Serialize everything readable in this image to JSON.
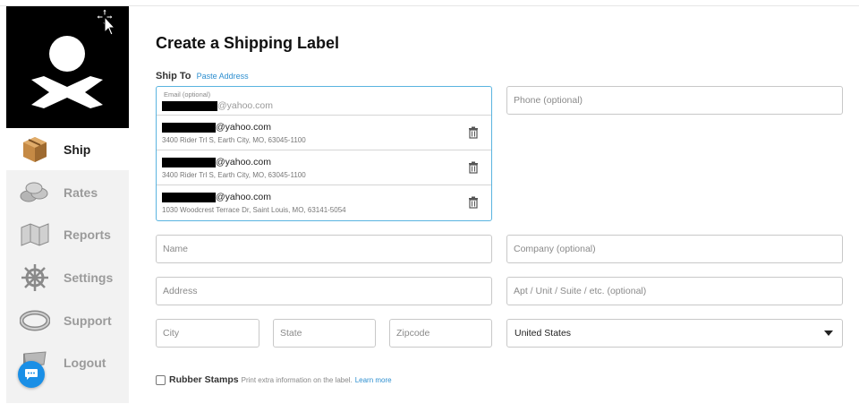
{
  "sidebar": {
    "items": [
      {
        "label": "Ship",
        "active": true
      },
      {
        "label": "Rates"
      },
      {
        "label": "Reports"
      },
      {
        "label": "Settings"
      },
      {
        "label": "Support"
      },
      {
        "label": "Logout"
      }
    ]
  },
  "form": {
    "title": "Create a Shipping Label",
    "ship_to_label": "Ship To",
    "paste_address_link": "Paste Address",
    "email": {
      "label": "Email (optional)",
      "value_suffix": "@yahoo.com"
    },
    "suggestions": [
      {
        "email_suffix": "@yahoo.com",
        "address": "3400 Rider Trl S, Earth City, MO, 63045-1100"
      },
      {
        "email_suffix": "@yahoo.com",
        "address": "3400 Rider Trl S, Earth City, MO, 63045-1100"
      },
      {
        "email_suffix": "@yahoo.com",
        "address": "1030 Woodcrest Terrace Dr, Saint Louis, MO, 63141-5054"
      }
    ],
    "placeholders": {
      "phone": "Phone (optional)",
      "name": "Name",
      "company": "Company (optional)",
      "address": "Address",
      "apt": "Apt / Unit / Suite / etc. (optional)",
      "city": "City",
      "state": "State",
      "zipcode": "Zipcode"
    },
    "country_selected": "United States",
    "rubber_stamps": {
      "label": "Rubber Stamps",
      "description": "Print extra information on the label.",
      "link": "Learn more"
    }
  },
  "colors": {
    "accent": "#2e8fd0",
    "focus_border": "#5ab4e0",
    "chat_button": "#1a8fe6",
    "logo_bg": "#000000"
  }
}
